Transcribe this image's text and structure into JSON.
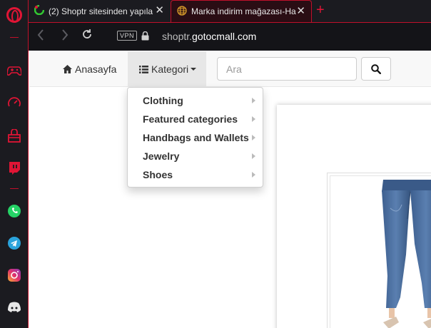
{
  "browser": {
    "tabs": [
      {
        "title": "(2) Shoptr sitesinden yapıla",
        "close": "✕"
      },
      {
        "title": "Marka indirim mağazası-Ha",
        "close": "✕"
      }
    ],
    "new_tab": "+",
    "vpn_label": "VPN",
    "url_sub": "shoptr.",
    "url_domain": "gotocmall.com"
  },
  "sidebar": {
    "icons": [
      "opera-logo",
      "gamepad-icon",
      "speedometer-icon",
      "bag-icon",
      "twitch-icon",
      "whatsapp-icon",
      "telegram-icon",
      "instagram-icon",
      "discord-icon"
    ],
    "accent_color": "#e01535"
  },
  "navbar": {
    "home_label": "Anasayfa",
    "category_label": "Kategori",
    "search_placeholder": "Ara"
  },
  "dropdown": {
    "items": [
      {
        "label": "Clothing"
      },
      {
        "label": "Featured categories"
      },
      {
        "label": "Handbags and Wallets"
      },
      {
        "label": "Jewelry"
      },
      {
        "label": "Shoes"
      }
    ]
  }
}
